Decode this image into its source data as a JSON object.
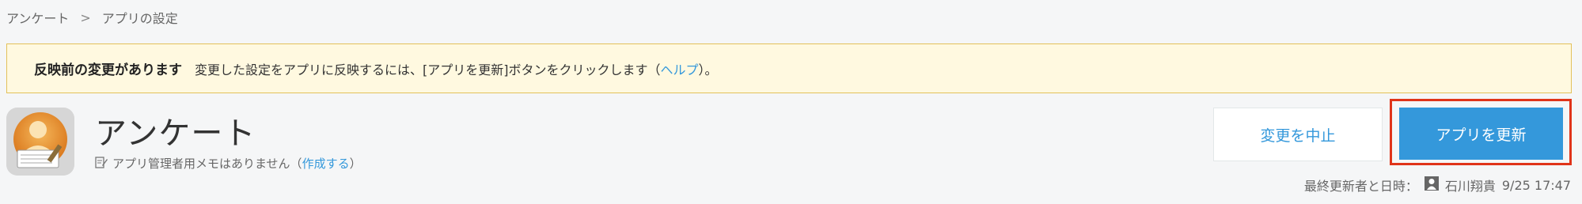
{
  "breadcrumb": {
    "items": [
      "アンケート",
      "アプリの設定"
    ],
    "separator": ">"
  },
  "notice": {
    "title": "反映前の変更があります",
    "message_before": "変更した設定をアプリに反映するには、[アプリを更新]ボタンをクリックします（",
    "help_link": "ヘルプ",
    "message_after": "）。"
  },
  "app": {
    "icon": "survey-person-icon",
    "title": "アンケート",
    "memo_icon": "edit-note-icon",
    "memo_text": "アプリ管理者用メモはありません（",
    "memo_link": "作成する",
    "memo_after": "）"
  },
  "actions": {
    "cancel_label": "変更を中止",
    "update_label": "アプリを更新"
  },
  "last_updated": {
    "label": "最終更新者と日時：",
    "user_icon": "user-icon",
    "user": "石川翔貴",
    "datetime": "9/25 17:47"
  },
  "colors": {
    "accent": "#3498db",
    "notice_bg": "#fff9e0",
    "notice_border": "#e3c15a",
    "highlight": "#e0341a"
  }
}
